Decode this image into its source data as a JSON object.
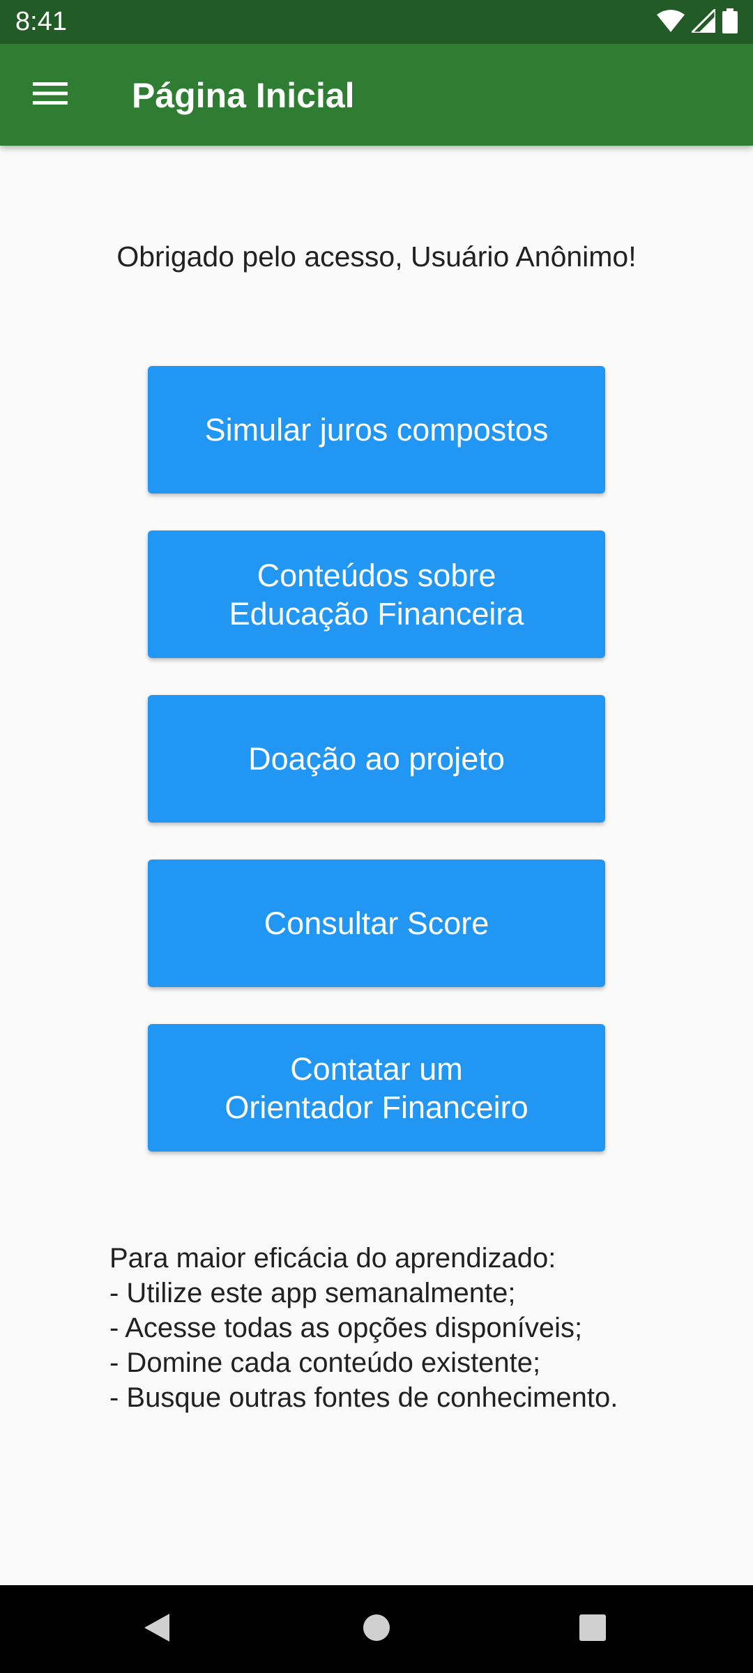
{
  "status_bar": {
    "time": "8:41",
    "icons": [
      "wifi-icon",
      "signal-icon",
      "battery-icon"
    ],
    "background": "#225b26"
  },
  "app_bar": {
    "title": "Página Inicial",
    "menu_icon": "menu-icon",
    "background": "#2e7d32"
  },
  "main": {
    "greeting": "Obrigado pelo acesso, Usuário Anônimo!",
    "buttons": [
      {
        "label": "Simular juros compostos"
      },
      {
        "label": "Conteúdos sobre\nEducação Financeira"
      },
      {
        "label": "Doação ao projeto"
      },
      {
        "label": "Consultar Score"
      },
      {
        "label": "Contatar um\nOrientador Financeiro"
      }
    ],
    "button_color": "#2196f3",
    "tips": {
      "heading": "Para maior eficácia do aprendizado:",
      "items": [
        "- Utilize este app semanalmente;",
        "- Acesse todas as opções disponíveis;",
        "- Domine cada conteúdo existente;",
        "- Busque outras fontes de conhecimento."
      ]
    }
  },
  "nav_bar": {
    "buttons": [
      "back-icon",
      "home-icon",
      "recents-icon"
    ]
  }
}
